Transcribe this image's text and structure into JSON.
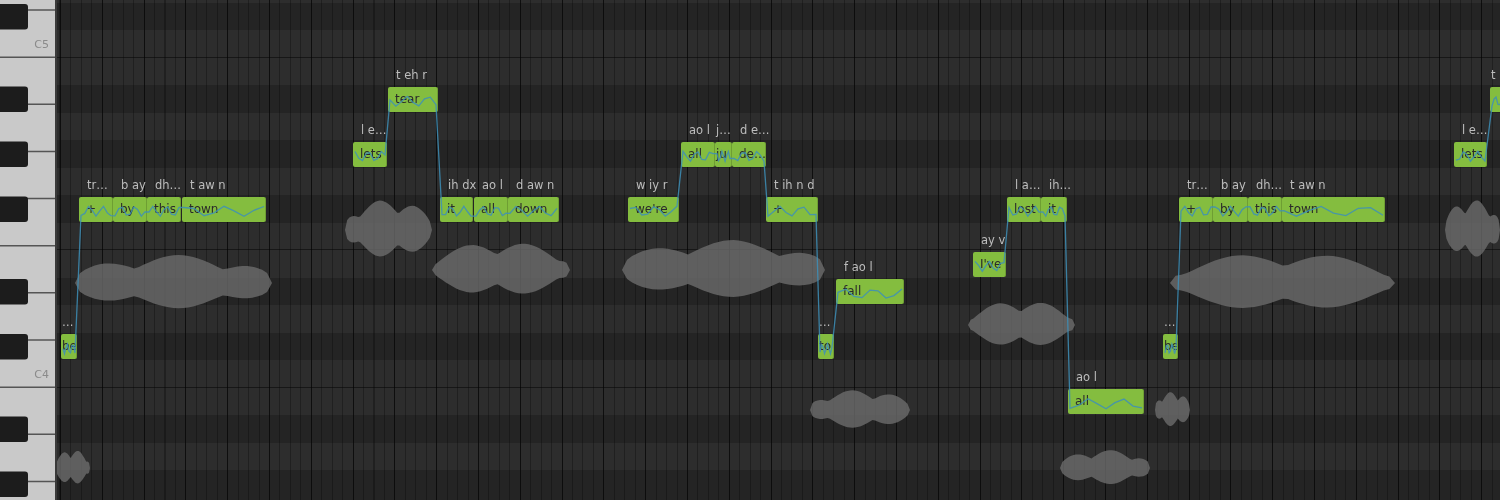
{
  "keyboard": {
    "labels": [
      "C5",
      "C4"
    ]
  },
  "notes": [
    {
      "lyric": "be",
      "phonemes": "…"
    },
    {
      "lyric": "+",
      "phonemes": "tr…"
    },
    {
      "lyric": "by",
      "phonemes": "b ay"
    },
    {
      "lyric": "this",
      "phonemes": "dh…"
    },
    {
      "lyric": "town",
      "phonemes": "t aw n"
    },
    {
      "lyric": "lets",
      "phonemes": "l e…"
    },
    {
      "lyric": "tear",
      "phonemes": "t eh r"
    },
    {
      "lyric": "it",
      "phonemes": "ih dx"
    },
    {
      "lyric": "all",
      "phonemes": "ao l"
    },
    {
      "lyric": "down",
      "phonemes": "d aw n"
    },
    {
      "lyric": "we're",
      "phonemes": "w iy r"
    },
    {
      "lyric": "all",
      "phonemes": "ao l"
    },
    {
      "lyric": "ju",
      "phonemes": "j…"
    },
    {
      "lyric": "de…",
      "phonemes": "d e…"
    },
    {
      "lyric": "+",
      "phonemes": "t ih n d"
    },
    {
      "lyric": "to",
      "phonemes": "…"
    },
    {
      "lyric": "fall",
      "phonemes": "f ao l"
    },
    {
      "lyric": "I've",
      "phonemes": "ay v"
    },
    {
      "lyric": "lost",
      "phonemes": "l a…"
    },
    {
      "lyric": "it",
      "phonemes": "ih…"
    },
    {
      "lyric": "all",
      "phonemes": "ao l"
    },
    {
      "lyric": "be",
      "phonemes": "…"
    },
    {
      "lyric": "+",
      "phonemes": "tr…"
    },
    {
      "lyric": "by",
      "phonemes": "b ay"
    },
    {
      "lyric": "this",
      "phonemes": "dh…"
    },
    {
      "lyric": "town",
      "phonemes": "t aw n"
    },
    {
      "lyric": "lets",
      "phonemes": "l e…"
    },
    {
      "phonemes": "t"
    }
  ]
}
